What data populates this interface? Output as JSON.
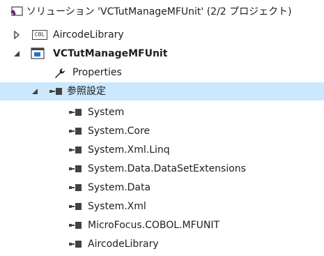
{
  "solution": {
    "label": "ソリューション 'VCTutManageMFUnit' (2/2 プロジェクト)"
  },
  "projects": [
    {
      "label": "AircodeLibrary",
      "badge": "CBL"
    },
    {
      "label": "VCTutManageMFUnit"
    }
  ],
  "project_children": {
    "properties_label": "Properties",
    "references_label": "参照設定"
  },
  "references": [
    "System",
    "System.Core",
    "System.Xml.Linq",
    "System.Data.DataSetExtensions",
    "System.Data",
    "System.Xml",
    "MicroFocus.COBOL.MFUNIT",
    "AircodeLibrary"
  ],
  "colors": {
    "selection": "#cce8ff",
    "solution_icon": "#68217a",
    "text": "#1e1e1e"
  }
}
